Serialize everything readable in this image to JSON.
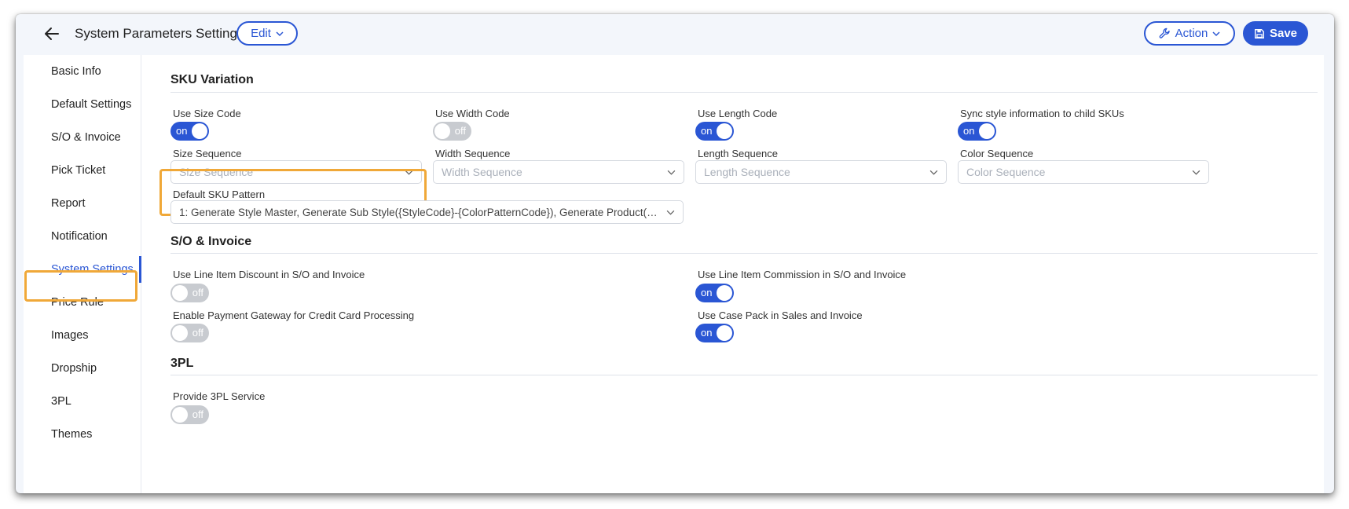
{
  "header": {
    "title": "System Parameters Settings",
    "edit_label": "Edit",
    "action_label": "Action",
    "save_label": "Save"
  },
  "sidebar": {
    "items": [
      {
        "label": "Basic Info"
      },
      {
        "label": "Default Settings"
      },
      {
        "label": "S/O & Invoice"
      },
      {
        "label": "Pick Ticket"
      },
      {
        "label": "Report"
      },
      {
        "label": "Notification"
      },
      {
        "label": "System Settings",
        "active": true
      },
      {
        "label": "Price Rule"
      },
      {
        "label": "Images"
      },
      {
        "label": "Dropship"
      },
      {
        "label": "3PL"
      },
      {
        "label": "Themes"
      }
    ]
  },
  "sku_variation": {
    "title": "SKU Variation",
    "use_size_code": {
      "label": "Use Size Code",
      "state": "on"
    },
    "use_width_code": {
      "label": "Use Width Code",
      "state": "off"
    },
    "use_length_code": {
      "label": "Use Length Code",
      "state": "on"
    },
    "sync_style": {
      "label": "Sync style information to child SKUs",
      "state": "on"
    },
    "size_sequence": {
      "label": "Size Sequence",
      "placeholder": "Size Sequence"
    },
    "width_sequence": {
      "label": "Width Sequence",
      "placeholder": "Width Sequence"
    },
    "length_sequence": {
      "label": "Length Sequence",
      "placeholder": "Length Sequence"
    },
    "color_sequence": {
      "label": "Color Sequence",
      "placeholder": "Color Sequence"
    },
    "default_sku_pattern": {
      "label": "Default SKU Pattern",
      "value": "1: Generate Style Master, Generate Sub Style({StyleCode}-{ColorPatternCode}), Generate Product({StyleCode}-{ColorPatternCode}-{SizeCode})"
    }
  },
  "so_invoice": {
    "title": "S/O & Invoice",
    "line_item_discount": {
      "label": "Use Line Item Discount in S/O and Invoice",
      "state": "off"
    },
    "line_item_commission": {
      "label": "Use Line Item Commission in S/O and Invoice",
      "state": "on"
    },
    "payment_gateway": {
      "label": "Enable Payment Gateway for Credit Card Processing",
      "state": "off"
    },
    "case_pack": {
      "label": "Use Case Pack in Sales and Invoice",
      "state": "on"
    }
  },
  "tpl": {
    "title": "3PL",
    "provide_service": {
      "label": "Provide 3PL Service",
      "state": "off"
    }
  },
  "colors": {
    "accent": "#2a56d4",
    "highlight": "#f0a838",
    "toggle_off": "#c8cbd0"
  },
  "icons": {
    "back": "arrow-left-icon",
    "action": "wrench-icon",
    "save": "floppy-disk-icon",
    "dropdown": "chevron-down-icon"
  }
}
